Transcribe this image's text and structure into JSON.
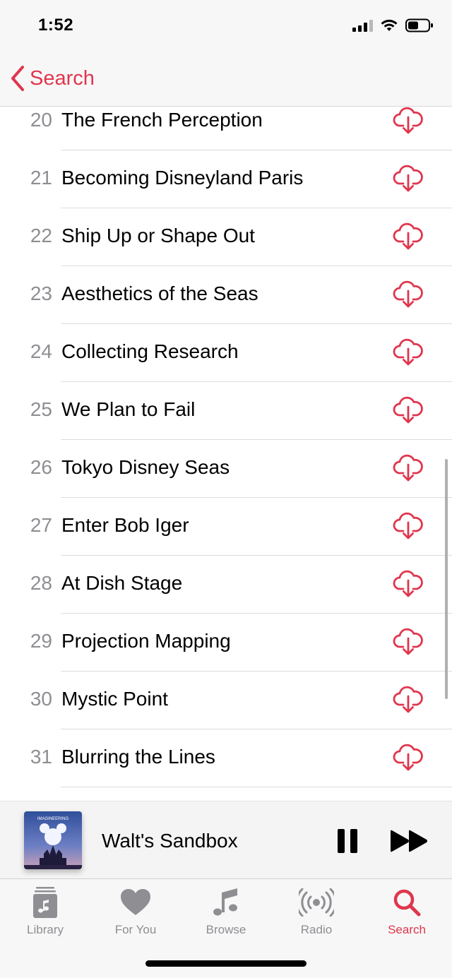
{
  "status_bar": {
    "time": "1:52"
  },
  "nav": {
    "back_label": "Search"
  },
  "episodes": [
    {
      "number": "20",
      "title": "The French Perception"
    },
    {
      "number": "21",
      "title": "Becoming Disneyland Paris"
    },
    {
      "number": "22",
      "title": "Ship Up or Shape Out"
    },
    {
      "number": "23",
      "title": "Aesthetics of the Seas"
    },
    {
      "number": "24",
      "title": "Collecting Research"
    },
    {
      "number": "25",
      "title": "We Plan to Fail"
    },
    {
      "number": "26",
      "title": "Tokyo Disney Seas"
    },
    {
      "number": "27",
      "title": "Enter Bob Iger"
    },
    {
      "number": "28",
      "title": "At Dish Stage"
    },
    {
      "number": "29",
      "title": "Projection Mapping"
    },
    {
      "number": "30",
      "title": "Mystic Point"
    },
    {
      "number": "31",
      "title": "Blurring the Lines"
    }
  ],
  "now_playing": {
    "title": "Walt's Sandbox",
    "artwork_text": "IMAGINEERING"
  },
  "tabs": [
    {
      "label": "Library",
      "icon": "library-icon"
    },
    {
      "label": "For You",
      "icon": "heart-icon"
    },
    {
      "label": "Browse",
      "icon": "music-note-icon"
    },
    {
      "label": "Radio",
      "icon": "radio-broadcast-icon"
    },
    {
      "label": "Search",
      "icon": "search-icon",
      "active": true
    }
  ],
  "colors": {
    "accent": "#e0364d",
    "inactive": "#8e8e93"
  }
}
